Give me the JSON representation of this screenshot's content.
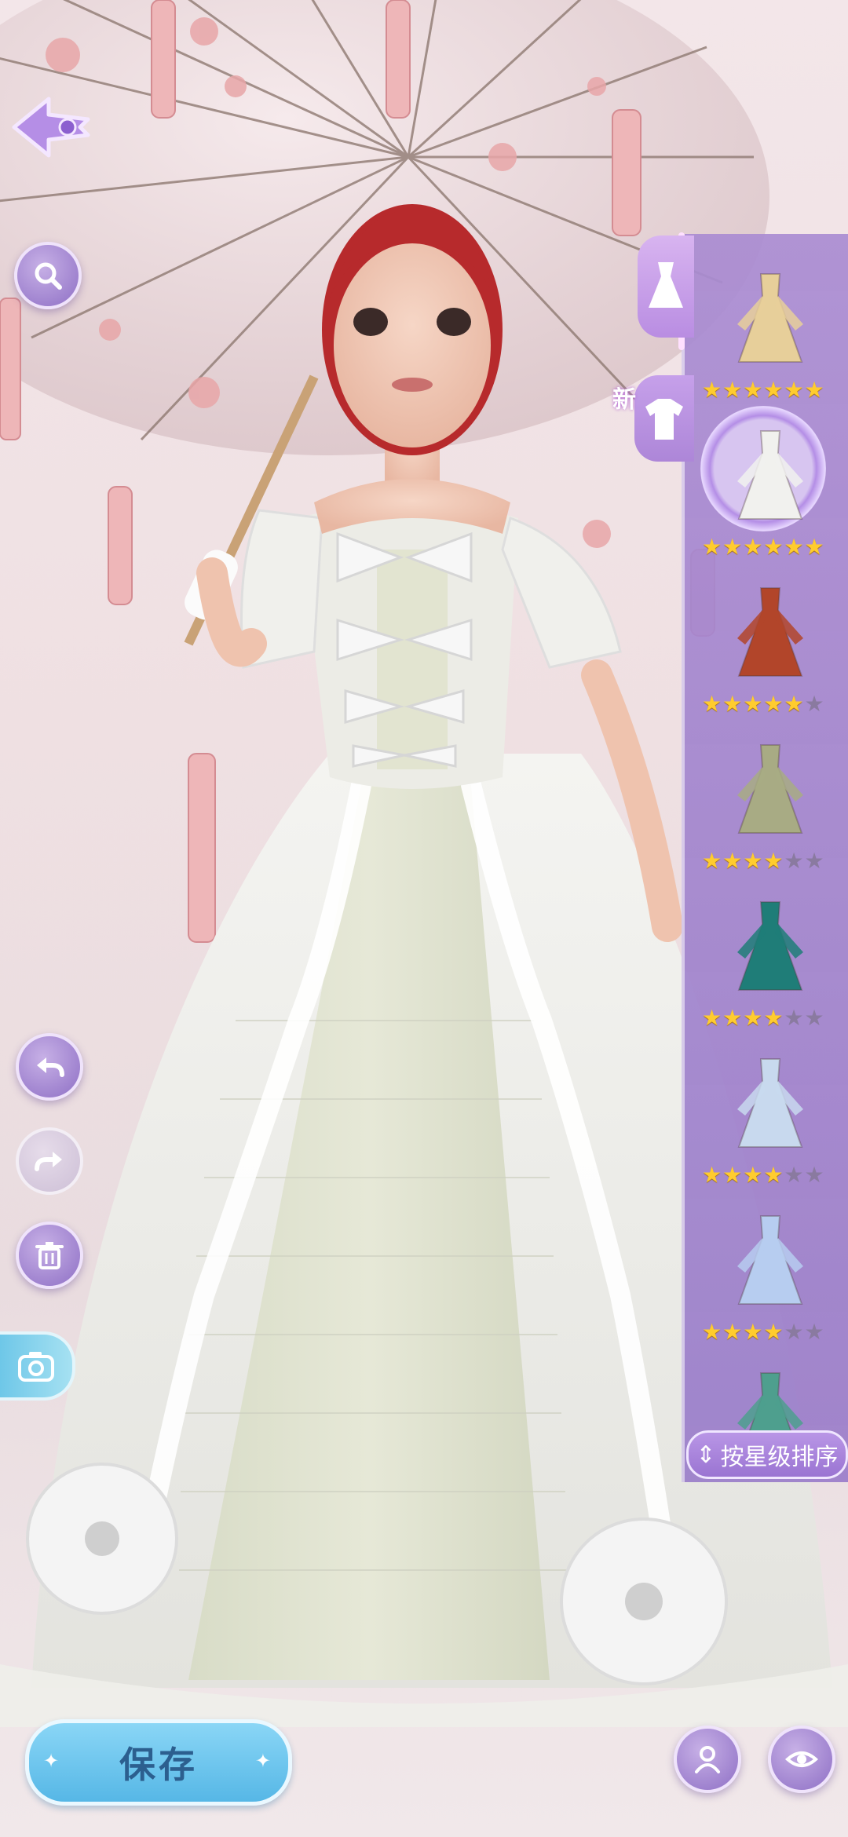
{
  "new_badge": "新",
  "sort_button": {
    "label": "按星级排序"
  },
  "save_button": {
    "label": "保存"
  },
  "outfits": [
    {
      "name": "gold-robe",
      "stars": 6,
      "max": 6,
      "color": "#e7cf9a"
    },
    {
      "name": "white-gown",
      "stars": 6,
      "max": 6,
      "color": "#f1f1ee",
      "selected": true
    },
    {
      "name": "red-hanfu",
      "stars": 5,
      "max": 6,
      "color": "#b2452a"
    },
    {
      "name": "olive-dress",
      "stars": 4,
      "max": 6,
      "color": "#a8ab84"
    },
    {
      "name": "teal-robe",
      "stars": 4,
      "max": 6,
      "color": "#1f7d78"
    },
    {
      "name": "blue-cream-robe",
      "stars": 4,
      "max": 6,
      "color": "#c8d9ee"
    },
    {
      "name": "light-blue-robe",
      "stars": 4,
      "max": 6,
      "color": "#b7cdf0"
    },
    {
      "name": "green-robe",
      "stars": 0,
      "max": 6,
      "color": "#4e9f8e"
    }
  ],
  "colors": {
    "accent": "#9a74d2",
    "save": "#56b7e6",
    "star": "#ffcc2e"
  }
}
